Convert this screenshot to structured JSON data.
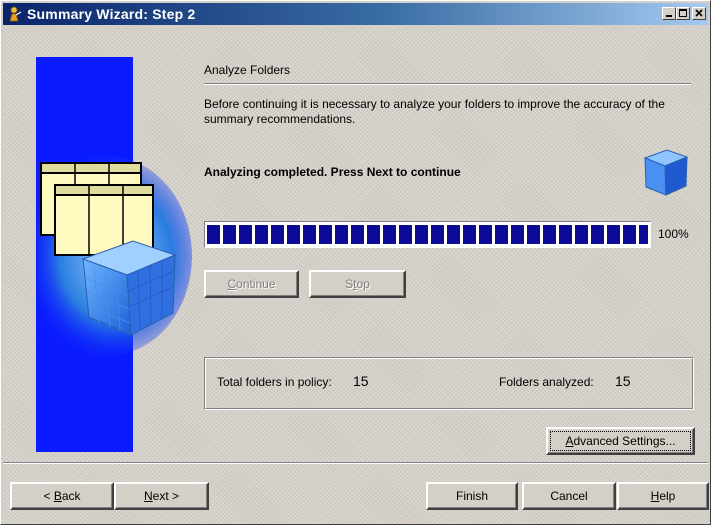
{
  "window": {
    "title": "Summary Wizard: Step 2",
    "icon": "wizard-icon",
    "controls": [
      "minimize-icon",
      "maximize-icon",
      "close-icon"
    ]
  },
  "section": {
    "title": "Analyze Folders",
    "description": "Before continuing it is necessary to analyze your folders to improve the accuracy of the summary recommendations."
  },
  "status": {
    "message": "Analyzing completed. Press Next to continue",
    "icon": "cube-icon"
  },
  "progress": {
    "value": 100,
    "label": "100%"
  },
  "actions": {
    "continue_label": "Continue",
    "continue_mnemonic": "C",
    "continue_rest": "ontinue",
    "stop_label": "Stop",
    "stop_pre": "S",
    "stop_mnemonic": "t",
    "stop_rest": "op"
  },
  "stats": {
    "total_label": "Total folders in policy:",
    "total_value": "15",
    "analyzed_label": "Folders analyzed:",
    "analyzed_value": "15"
  },
  "advanced": {
    "label": "Advanced Settings...",
    "mnemonic": "A",
    "rest": "dvanced Settings..."
  },
  "footer": {
    "back_prefix": "< ",
    "back_mnemonic": "B",
    "back_rest": "ack",
    "back_label": "< Back",
    "next_mnemonic": "N",
    "next_rest": "ext >",
    "next_label": "Next >",
    "finish_label": "Finish",
    "cancel_label": "Cancel",
    "help_mnemonic": "H",
    "help_rest": "elp",
    "help_label": "Help"
  },
  "colors": {
    "titlebar_start": "#0a246a",
    "titlebar_end": "#a6caf0",
    "panel_blue": "#0a1cff",
    "progress_blue": "#0a0a96",
    "face": "#d4d0c8"
  }
}
